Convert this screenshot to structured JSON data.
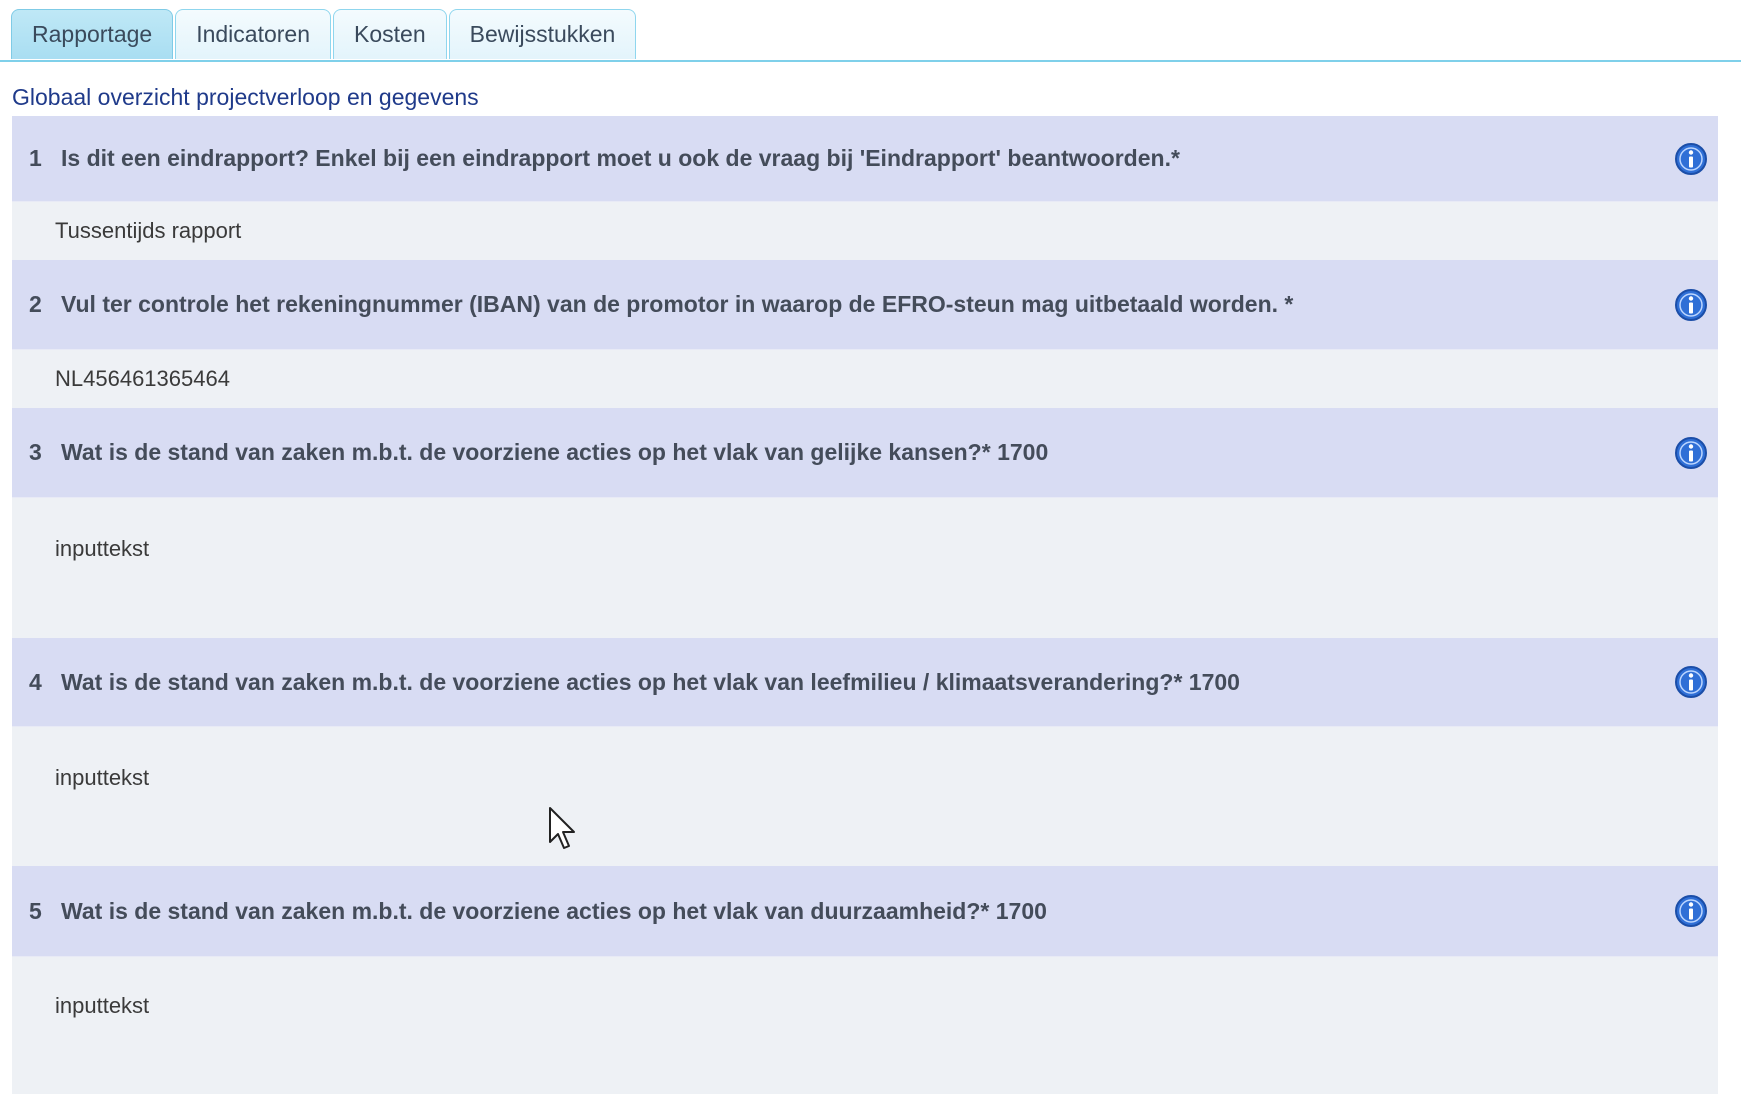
{
  "tabs": {
    "rapportage": "Rapportage",
    "indicatoren": "Indicatoren",
    "kosten": "Kosten",
    "bewijsstukken": "Bewijsstukken"
  },
  "section_title": "Globaal overzicht projectverloop en gegevens",
  "questions": [
    {
      "number": "1",
      "text": "Is dit een eindrapport? Enkel bij een eindrapport moet u ook de vraag bij 'Eindrapport' beantwoorden.*",
      "answer": "Tussentijds rapport"
    },
    {
      "number": "2",
      "text": "Vul ter controle het rekeningnummer (IBAN) van de promotor in waarop de EFRO-steun mag uitbetaald worden. *",
      "answer": "NL456461365464"
    },
    {
      "number": "3",
      "text": "Wat is de stand van zaken m.b.t. de voorziene acties op het vlak van gelijke kansen?* 1700",
      "answer": "inputtekst"
    },
    {
      "number": "4",
      "text": "Wat is de stand van zaken m.b.t. de voorziene acties op het vlak van leefmilieu / klimaatsverandering?* 1700",
      "answer": "inputtekst"
    },
    {
      "number": "5",
      "text": "Wat is de stand van zaken m.b.t. de voorziene acties op het vlak van duurzaamheid?* 1700",
      "answer": "inputtekst"
    }
  ],
  "icons": {
    "info": "info-icon",
    "cursor": "mouse-pointer-icon"
  },
  "colors": {
    "question_bg": "#d8dcf3",
    "answer_bg": "#eef1f5",
    "tab_active": "#b5e3f4",
    "accent_line": "#7fd0ea",
    "title_color": "#1f3a8a"
  }
}
